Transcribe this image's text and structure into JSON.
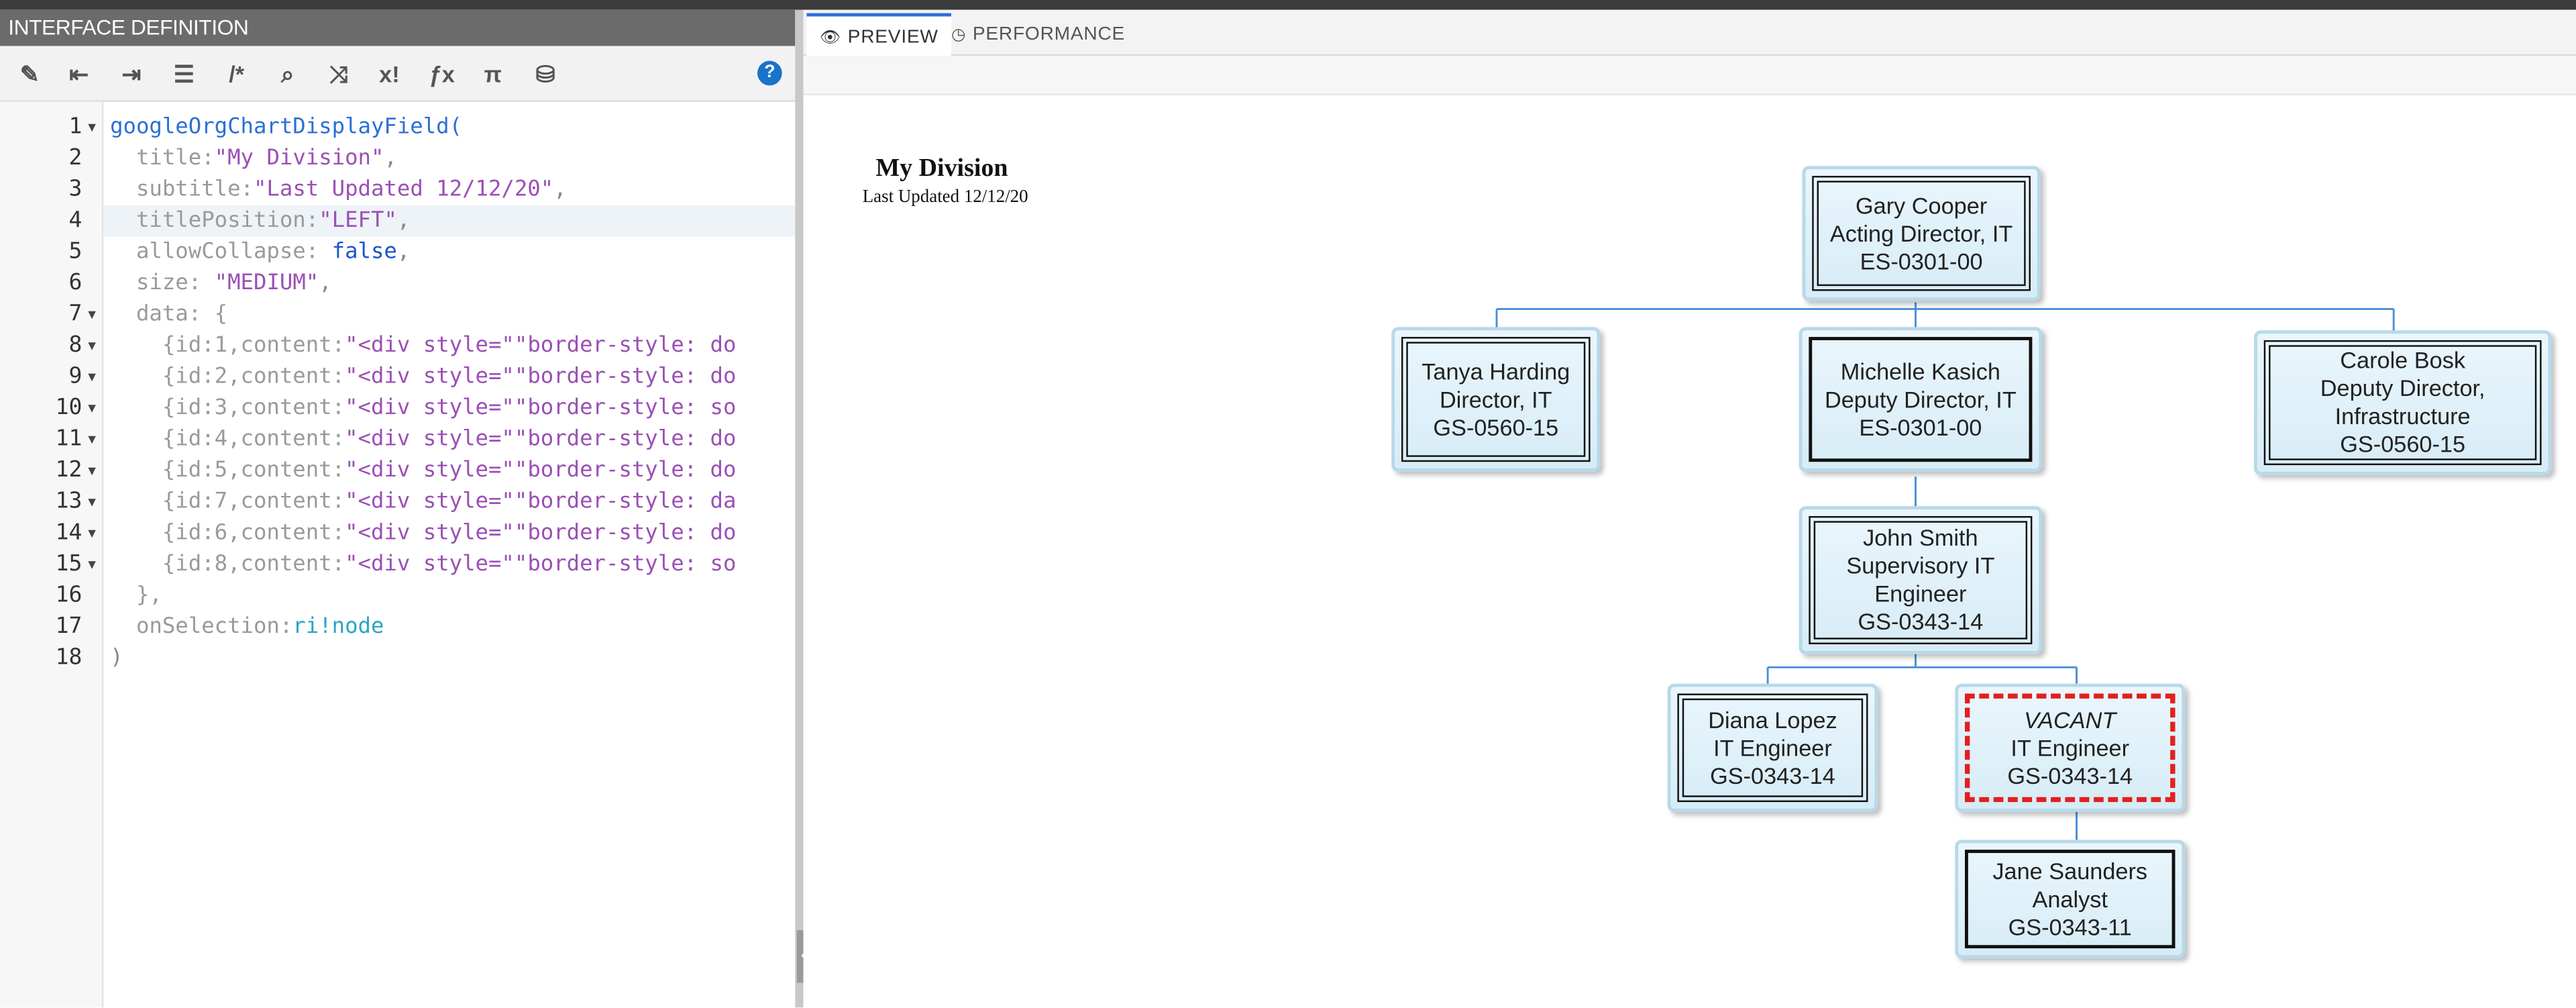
{
  "left_panel": {
    "header": "INTERFACE DEFINITION",
    "toolbar": [
      {
        "name": "magic-wand-icon",
        "glyph": "✎"
      },
      {
        "name": "outdent-icon",
        "glyph": "⇤"
      },
      {
        "name": "indent-icon",
        "glyph": "⇥"
      },
      {
        "name": "format-icon",
        "glyph": "☰"
      },
      {
        "name": "comment-icon",
        "glyph": "/*"
      },
      {
        "name": "search-icon",
        "glyph": "⌕"
      },
      {
        "name": "shuffle-icon",
        "glyph": "⤨"
      },
      {
        "name": "factorial-icon",
        "glyph": "x!"
      },
      {
        "name": "function-icon",
        "glyph": "ƒx"
      },
      {
        "name": "pi-icon",
        "glyph": "π"
      },
      {
        "name": "database-search-icon",
        "glyph": "⛁"
      }
    ],
    "help_glyph": "?",
    "code_lines": [
      [
        {
          "t": "googleOrgChartDisplayField(",
          "c": "c-fn"
        }
      ],
      [
        {
          "t": "  title:",
          "c": "c-key"
        },
        {
          "t": "\"My Division\"",
          "c": "c-str"
        },
        {
          "t": ",",
          "c": "c-punc"
        }
      ],
      [
        {
          "t": "  subtitle:",
          "c": "c-key"
        },
        {
          "t": "\"Last Updated 12/12/20\"",
          "c": "c-str"
        },
        {
          "t": ",",
          "c": "c-punc"
        }
      ],
      [
        {
          "t": "  titlePosition:",
          "c": "c-key"
        },
        {
          "t": "\"LEFT\"",
          "c": "c-str"
        },
        {
          "t": ",",
          "c": "c-punc"
        }
      ],
      [
        {
          "t": "  allowCollapse: ",
          "c": "c-key"
        },
        {
          "t": "false",
          "c": "c-bool"
        },
        {
          "t": ",",
          "c": "c-punc"
        }
      ],
      [
        {
          "t": "  size: ",
          "c": "c-key"
        },
        {
          "t": "\"MEDIUM\"",
          "c": "c-str"
        },
        {
          "t": ",",
          "c": "c-punc"
        }
      ],
      [
        {
          "t": "  data: {",
          "c": "c-key"
        }
      ],
      [
        {
          "t": "    {id:1,content:",
          "c": "c-key"
        },
        {
          "t": "\"<div style=\"\"border-style: do",
          "c": "c-str"
        }
      ],
      [
        {
          "t": "    {id:2,content:",
          "c": "c-key"
        },
        {
          "t": "\"<div style=\"\"border-style: do",
          "c": "c-str"
        }
      ],
      [
        {
          "t": "    {id:3,content:",
          "c": "c-key"
        },
        {
          "t": "\"<div style=\"\"border-style: so",
          "c": "c-str"
        }
      ],
      [
        {
          "t": "    {id:4,content:",
          "c": "c-key"
        },
        {
          "t": "\"<div style=\"\"border-style: do",
          "c": "c-str"
        }
      ],
      [
        {
          "t": "    {id:5,content:",
          "c": "c-key"
        },
        {
          "t": "\"<div style=\"\"border-style: do",
          "c": "c-str"
        }
      ],
      [
        {
          "t": "    {id:7,content:",
          "c": "c-key"
        },
        {
          "t": "\"<div style=\"\"border-style: da",
          "c": "c-str"
        }
      ],
      [
        {
          "t": "    {id:6,content:",
          "c": "c-key"
        },
        {
          "t": "\"<div style=\"\"border-style: do",
          "c": "c-str"
        }
      ],
      [
        {
          "t": "    {id:8,content:",
          "c": "c-key"
        },
        {
          "t": "\"<div style=\"\"border-style: so",
          "c": "c-str"
        }
      ],
      [
        {
          "t": "  },",
          "c": "c-key"
        }
      ],
      [
        {
          "t": "  onSelection:",
          "c": "c-key"
        },
        {
          "t": "ri!node",
          "c": "c-ri"
        }
      ],
      [
        {
          "t": ")",
          "c": "c-punc"
        }
      ]
    ],
    "line_numbers": [
      "1",
      "2",
      "3",
      "4",
      "5",
      "6",
      "7",
      "8",
      "9",
      "10",
      "11",
      "12",
      "13",
      "14",
      "15",
      "16",
      "17",
      "18"
    ],
    "fold_lines": [
      1,
      7,
      8,
      9,
      10,
      11,
      12,
      13,
      14,
      15
    ],
    "active_line": 4
  },
  "right_panel": {
    "tabs": [
      {
        "label": "PREVIEW",
        "icon": "eye-icon",
        "glyph": "👁",
        "active": true
      },
      {
        "label": "PERFORMANCE",
        "icon": "clock-icon",
        "glyph": "◷",
        "active": false
      }
    ],
    "collapse_glyph": "⇐",
    "org_chart": {
      "title": "My Division",
      "subtitle": "Last Updated 12/12/20",
      "nodes": [
        {
          "id": "gary",
          "lines": [
            "Gary Cooper",
            "Acting Director, IT",
            "ES-0301-00"
          ],
          "border": "double"
        },
        {
          "id": "tanya",
          "lines": [
            "Tanya Harding",
            "Director, IT",
            "GS-0560-15"
          ],
          "border": "double"
        },
        {
          "id": "michelle",
          "lines": [
            "Michelle Kasich",
            "Deputy Director, IT",
            "ES-0301-00"
          ],
          "border": "solid"
        },
        {
          "id": "carole",
          "lines": [
            "Carole Bosk",
            "Deputy Director,",
            "Infrastructure",
            "GS-0560-15"
          ],
          "border": "double"
        },
        {
          "id": "john",
          "lines": [
            "John Smith",
            "Supervisory IT",
            "Engineer",
            "GS-0343-14"
          ],
          "border": "double"
        },
        {
          "id": "diana",
          "lines": [
            "Diana Lopez",
            "IT Engineer",
            "GS-0343-14"
          ],
          "border": "double"
        },
        {
          "id": "vacant",
          "lines": [
            "VACANT",
            "IT Engineer",
            "GS-0343-14"
          ],
          "border": "dashed",
          "italic_first": true
        },
        {
          "id": "jane",
          "lines": [
            "Jane Saunders",
            "Analyst",
            "GS-0343-11"
          ],
          "border": "solid"
        }
      ]
    }
  },
  "colors": {
    "link_line": "#4a90d9",
    "node_bg": "#e1f1f9",
    "vacant_border": "#e41e1e",
    "accent": "#2a6fd6"
  }
}
